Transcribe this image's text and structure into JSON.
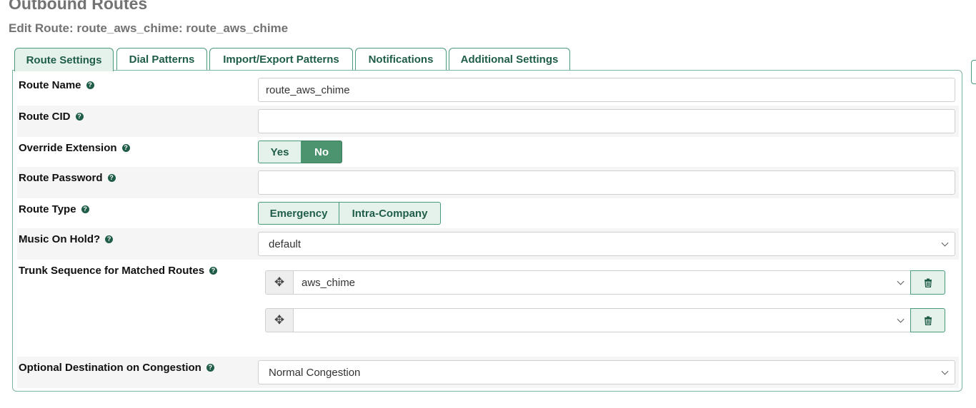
{
  "header": {
    "title": "Outbound Routes",
    "subtitle": "Edit Route: route_aws_chime: route_aws_chime"
  },
  "tabs": [
    {
      "label": "Route Settings",
      "active": true
    },
    {
      "label": "Dial Patterns",
      "active": false
    },
    {
      "label": "Import/Export Patterns",
      "active": false
    },
    {
      "label": "Notifications",
      "active": false
    },
    {
      "label": "Additional Settings",
      "active": false
    }
  ],
  "form": {
    "route_name": {
      "label": "Route Name",
      "value": "route_aws_chime"
    },
    "route_cid": {
      "label": "Route CID",
      "value": ""
    },
    "override_extension": {
      "label": "Override Extension",
      "options": [
        "Yes",
        "No"
      ],
      "selected": "No"
    },
    "route_password": {
      "label": "Route Password",
      "value": ""
    },
    "route_type": {
      "label": "Route Type",
      "options": [
        "Emergency",
        "Intra-Company"
      ]
    },
    "music_on_hold": {
      "label": "Music On Hold?",
      "value": "default"
    },
    "trunk_sequence": {
      "label": "Trunk Sequence for Matched Routes",
      "trunks": [
        "aws_chime",
        ""
      ]
    },
    "congestion_destination": {
      "label": "Optional Destination on Congestion",
      "value": "Normal Congestion"
    }
  },
  "icons": {
    "help": "question-circle-icon",
    "drag": "move-arrows-icon",
    "delete": "trash-icon",
    "dropdown": "chevron-down-icon"
  },
  "colors": {
    "accent": "#4b946f",
    "accent_light": "#e5f2ec",
    "accent_text": "#1f5d49",
    "header_gray": "#737373"
  }
}
